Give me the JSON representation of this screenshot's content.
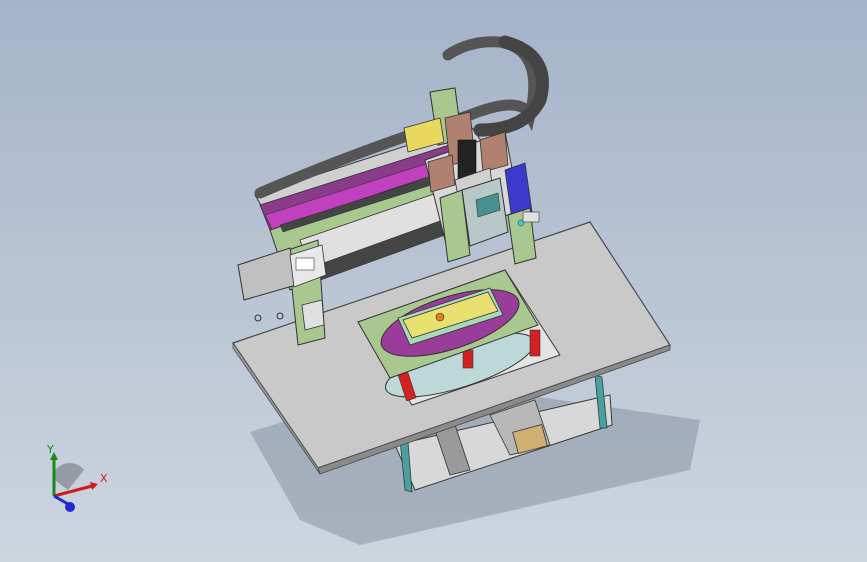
{
  "viewport": {
    "background_top": "#a4b3c8",
    "background_bottom": "#cdd5df"
  },
  "model": {
    "colors": {
      "table": "#c9c9c9",
      "table_edge": "#4a4a4a",
      "frame_green": "#a8c890",
      "frame_purple": "#8a3b8a",
      "magenta": "#c040c0",
      "yellow": "#e8d860",
      "red": "#d42020",
      "teal": "#4aa0a0",
      "brown": "#b08070",
      "chain": "#555555"
    }
  },
  "triad": {
    "x_label": "X",
    "y_label": "Y",
    "x_color": "#d01c1c",
    "y_color": "#1a8a1a",
    "z_color": "#1c2ad0"
  }
}
